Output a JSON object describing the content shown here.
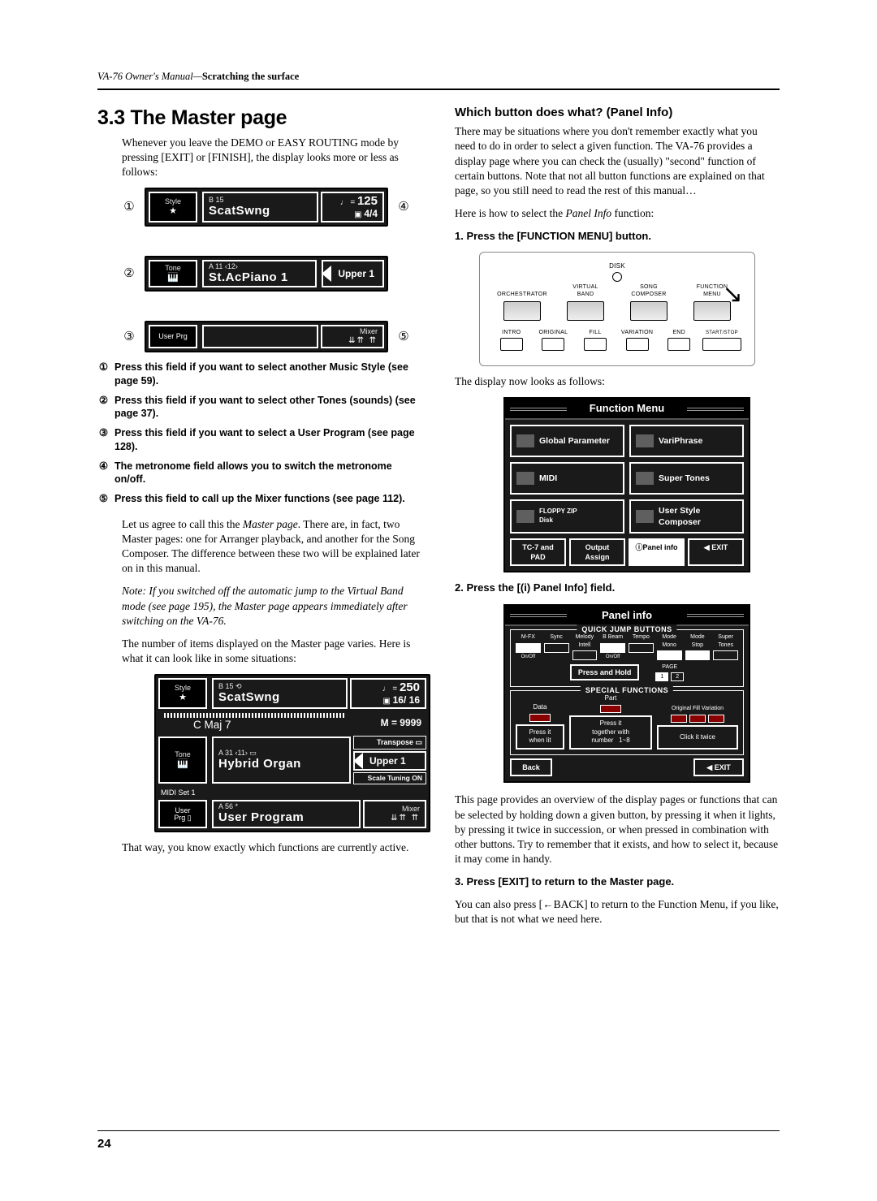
{
  "header": {
    "manual": "VA-76 Owner's Manual",
    "chapter": "Scratching the surface"
  },
  "left": {
    "section_title": "3.3 The Master page",
    "intro": "Whenever you leave the DEMO or EASY ROUTING mode by pressing [EXIT] or [FINISH], the display looks more or less as follows:",
    "lcd1": {
      "style_code": "B 15",
      "style_name": "ScatSwng",
      "tempo_label": "♩ =",
      "tempo_value": "125",
      "time_sig": "4/4",
      "tone_code": "A 11 ‹12›",
      "tone_name": "St.AcPiano 1",
      "upper_label": "Upper 1",
      "userprg_label": "User\nPrg",
      "mixer_label": "Mixer"
    },
    "callouts": [
      "Press this field if you want to select another Music Style (see page 59).",
      "Press this field if you want to select other Tones (sounds) (see page 37).",
      "Press this field if you want to select a User Program (see page 128).",
      "The metronome field allows you to switch the metronome on/off.",
      "Press this field to call up the Mixer functions (see page 112)."
    ],
    "callout_marks": [
      "①",
      "②",
      "③",
      "④",
      "⑤"
    ],
    "para2": "Let us agree to call this the Master page. There are, in fact, two Master pages: one for Arranger playback, and another for the Song Composer. The difference between these two will be explained later on in this manual.",
    "note": "Note: If you switched off the automatic jump to the Virtual Band mode (see page 195), the Master page appears immediately after switching on the VA-76.",
    "para3": "The number of items displayed on the Master page varies. Here is what it can look like in some situations:",
    "lcd2": {
      "style_code": "B 15",
      "style_name": "ScatSwng",
      "chord": "C Maj 7",
      "tempo_label": "♩ =",
      "tempo_value": "250",
      "time_sig": "16/ 16",
      "measure": "M = 9999",
      "tone_code": "A 31 ‹11›",
      "tone_name": "Hybrid Organ",
      "transpose": "Transpose",
      "upper_label": "Upper 1",
      "scale": "Scale Tuning ON",
      "midiset": "MIDI Set 1",
      "usr_code": "A 56  *",
      "usr_name": "User Program",
      "mixer_label": "Mixer"
    },
    "para4": "That way, you know exactly which functions are currently active."
  },
  "right": {
    "subhead": "Which button does what? (Panel Info)",
    "intro": "There may be situations where you don't remember exactly what you need to do in order to select a given function. The VA-76 provides a display page where you can check the (usually) \"second\" function of certain buttons. Note that not all button functions are explained on that page, so you still need to read the rest of this manual…",
    "howto": "Here is how to select the Panel Info function:",
    "step1": "1. Press the [FUNCTION MENU] button.",
    "hw_labels": {
      "disk": "DISK",
      "orch": "ORCHESTRATOR",
      "vb": "VIRTUAL\nBAND",
      "sc": "SONG\nCOMPOSER",
      "fm": "FUNCTION\nMENU",
      "intro": "INTRO",
      "orig": "ORIGINAL",
      "fill": "FILL",
      "var": "VARIATION",
      "end": "END",
      "ss": "START/STOP"
    },
    "after_hw": "The display now looks as follows:",
    "menu": {
      "title": "Function Menu",
      "items": [
        "Global Parameter",
        "VariPhrase",
        "MIDI",
        "Super Tones",
        "Disk",
        "User Style\nComposer"
      ],
      "bottom": [
        "TC-7 and PAD",
        "Output\nAssign",
        "ⓘPanel info",
        "◀︎ EXIT"
      ]
    },
    "step2": "2. Press the [(i) Panel Info] field.",
    "panel": {
      "title": "Panel info",
      "group1": "QUICK JUMP BUTTONS",
      "qjump": [
        "M-FX",
        "Sync",
        "Melody\nIntell",
        "B Beam",
        "Tempo",
        "Mode\nMono",
        "Mode\nStop",
        "Super\nTones"
      ],
      "hold": "Press and Hold",
      "page_l": "1",
      "page_r": "2",
      "page_lbl": "PAGE",
      "group2": "SPECIAL FUNCTIONS",
      "sf_left": "Press it\nwhen lit",
      "sf_left_lbl": "Data",
      "sf_mid": "Press it\ntogether with\nnumber   1~8",
      "sf_mid_lbl": "Part",
      "sf_right": "Click it twice",
      "sf_right_lbl": "Original   Fill   Variation",
      "back": "Back",
      "exit": "◀︎ EXIT"
    },
    "para2": "This page provides an overview of the display pages or functions that can be selected by holding down a given button, by pressing it when it lights, by pressing it twice in succession, or when pressed in combination with other buttons. Try to remember that it exists, and how to select it, because it may come in handy.",
    "step3": "3. Press [EXIT] to return to the Master page.",
    "para3": "You can also press [←BACK] to return to the Function Menu, if you like, but that is not what we need here."
  },
  "page_number": "24"
}
